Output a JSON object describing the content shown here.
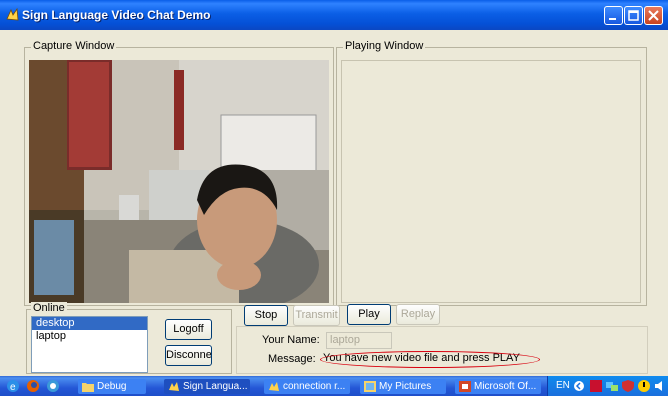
{
  "window": {
    "title": "Sign Language Video Chat Demo"
  },
  "capture": {
    "label": "Capture Window"
  },
  "playing": {
    "label": "Playing Window"
  },
  "online": {
    "label": "Online",
    "users": [
      "desktop",
      "laptop"
    ],
    "selected_index": 0
  },
  "buttons": {
    "logoff": "Logoff",
    "disconnect": "Disconnect",
    "stop": "Stop",
    "transmit": "Transmit",
    "play": "Play",
    "replay": "Replay"
  },
  "form": {
    "name_label": "Your Name:",
    "name_value": "laptop",
    "message_label": "Message:",
    "message_text": "You have new video file and press PLAY"
  },
  "taskbar": {
    "tasks": [
      "Debug",
      "Sign Langua...",
      "connection r...",
      "My Pictures",
      "Microsoft Of..."
    ],
    "tray_lang": "EN"
  },
  "colors": {
    "titlebar": "#0a5ee8",
    "highlight_oval": "#d8000e",
    "selection": "#316ac5"
  }
}
